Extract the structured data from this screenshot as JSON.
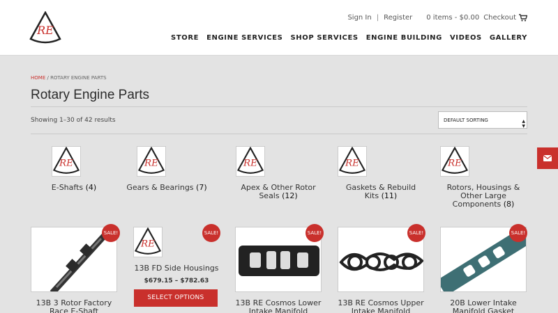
{
  "header": {
    "logo_text": "RE",
    "sign_in": "Sign In",
    "separator": "|",
    "register": "Register",
    "cart_summary": "0 items - $0.00",
    "checkout": "Checkout",
    "nav": [
      "STORE",
      "ENGINE SERVICES",
      "SHOP SERVICES",
      "ENGINE BUILDING",
      "VIDEOS",
      "GALLERY"
    ]
  },
  "breadcrumb": {
    "home": "HOME",
    "sep": " / ",
    "current": "ROTARY ENGINE PARTS"
  },
  "page_title": "Rotary Engine Parts",
  "result_count": "Showing 1–30 of 42 results",
  "sort": {
    "selected": "DEFAULT SORTING"
  },
  "categories": [
    {
      "name": "E-Shafts",
      "count": "(4)"
    },
    {
      "name": "Gears & Bearings",
      "count": "(7)"
    },
    {
      "name": "Apex & Other Rotor Seals",
      "count": "(12)"
    },
    {
      "name": "Gaskets & Rebuild Kits",
      "count": "(11)"
    },
    {
      "name": "Rotors, Housings & Other Large Components",
      "count": "(8)"
    }
  ],
  "products": [
    {
      "name": "13B 3 Rotor Factory Race E-Shaft",
      "sale": "SALE!"
    },
    {
      "name": "13B FD Side Housings",
      "sale": "SALE!",
      "price": "$679.15 – $782.63",
      "button": "SELECT OPTIONS"
    },
    {
      "name": "13B RE Cosmos Lower Intake Manifold",
      "sale": "SALE!"
    },
    {
      "name": "13B RE Cosmos Upper Intake Manifold",
      "sale": "SALE!"
    },
    {
      "name": "20B Lower Intake Manifold Gasket",
      "sale": "SALE!"
    }
  ],
  "colors": {
    "accent": "#c9302c",
    "background": "#e3e3e3"
  },
  "icons": {
    "cart": "shopping-cart-icon",
    "mail": "envelope-icon"
  }
}
